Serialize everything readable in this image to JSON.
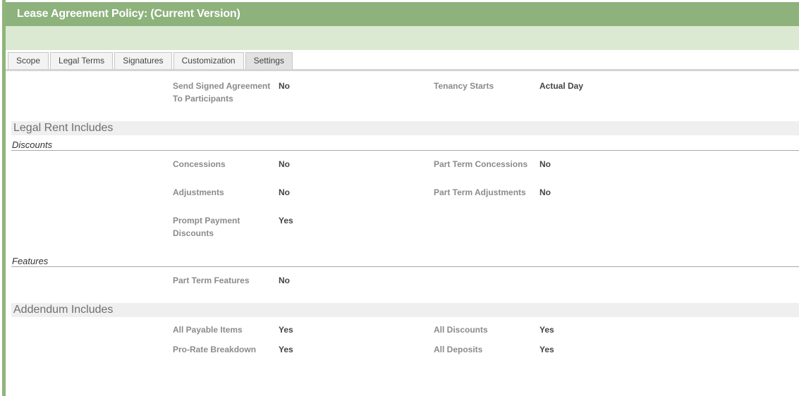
{
  "header": {
    "title": "Lease Agreement Policy: (Current Version)"
  },
  "tabs": [
    {
      "label": "Scope"
    },
    {
      "label": "Legal Terms"
    },
    {
      "label": "Signatures"
    },
    {
      "label": "Customization"
    },
    {
      "label": "Settings",
      "active": true
    }
  ],
  "settings": {
    "send_signed_label": "Send Signed Agreement To Participants",
    "send_signed_value": "No",
    "tenancy_starts_label": "Tenancy Starts",
    "tenancy_starts_value": "Actual Day"
  },
  "legal_rent": {
    "heading": "Legal Rent Includes",
    "discounts_heading": "Discounts",
    "concessions_label": "Concessions",
    "concessions_value": "No",
    "part_term_concessions_label": "Part Term Concessions",
    "part_term_concessions_value": "No",
    "adjustments_label": "Adjustments",
    "adjustments_value": "No",
    "part_term_adjustments_label": "Part Term Adjustments",
    "part_term_adjustments_value": "No",
    "prompt_payment_label": "Prompt Payment Discounts",
    "prompt_payment_value": "Yes",
    "features_heading": "Features",
    "part_term_features_label": "Part Term Features",
    "part_term_features_value": "No"
  },
  "addendum": {
    "heading": "Addendum Includes",
    "all_payable_label": "All Payable Items",
    "all_payable_value": "Yes",
    "all_discounts_label": "All Discounts",
    "all_discounts_value": "Yes",
    "prorate_label": "Pro-Rate Breakdown",
    "prorate_value": "Yes",
    "all_deposits_label": "All Deposits",
    "all_deposits_value": "Yes"
  },
  "colors": {
    "title_bar": "#8db27c",
    "sub_bar": "#dbe9d3",
    "section_band": "#efefef"
  }
}
